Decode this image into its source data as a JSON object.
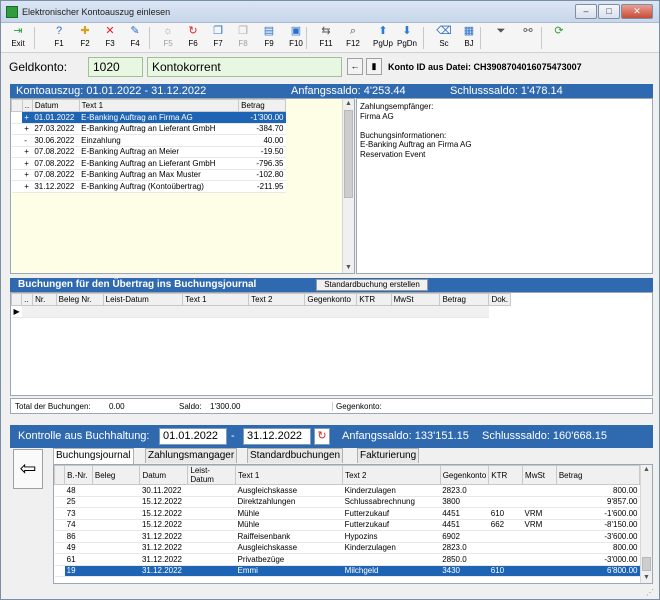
{
  "window": {
    "title": "Elektronischer Kontoauszug einlesen"
  },
  "toolbar": [
    {
      "name": "exit-button",
      "icon": "⇥",
      "label": "Exit",
      "color": "#2d9d3d",
      "disabled": false
    },
    {
      "name": "f1-button",
      "icon": "?",
      "label": "F1",
      "color": "#2a6fc9",
      "disabled": false
    },
    {
      "name": "f2-button",
      "icon": "✚",
      "label": "F2",
      "color": "#d8a21c",
      "disabled": false
    },
    {
      "name": "f3-button",
      "icon": "✕",
      "label": "F3",
      "color": "#d22",
      "disabled": false
    },
    {
      "name": "f4-button",
      "icon": "✎",
      "label": "F4",
      "color": "#2a6fc9",
      "disabled": false
    },
    {
      "name": "f5-button",
      "icon": "☼",
      "label": "F5",
      "color": "#aaa",
      "disabled": true
    },
    {
      "name": "f6-button",
      "icon": "↻",
      "label": "F6",
      "color": "#d22",
      "disabled": false
    },
    {
      "name": "f7-button",
      "icon": "❐",
      "label": "F7",
      "color": "#2a6fc9",
      "disabled": false
    },
    {
      "name": "f8-button",
      "icon": "❐",
      "label": "F8",
      "color": "#aaa",
      "disabled": true
    },
    {
      "name": "f9-button",
      "icon": "▤",
      "label": "F9",
      "color": "#2a6fc9",
      "disabled": false
    },
    {
      "name": "f10-button",
      "icon": "▣",
      "label": "F10",
      "color": "#2a6fc9",
      "disabled": false
    },
    {
      "name": "f11-button",
      "icon": "⇆",
      "label": "F11",
      "color": "#555",
      "disabled": false
    },
    {
      "name": "f12-button",
      "icon": "⌕",
      "label": "F12",
      "color": "#555",
      "disabled": false
    },
    {
      "name": "pgup-button",
      "icon": "⬆",
      "label": "PgUp",
      "color": "#2a7ad6",
      "disabled": false
    },
    {
      "name": "pgdn-button",
      "icon": "⬇",
      "label": "PgDn",
      "color": "#2a7ad6",
      "disabled": false
    },
    {
      "name": "sc-button",
      "icon": "⌫",
      "label": "Sc",
      "color": "#2a6fc9",
      "disabled": false
    },
    {
      "name": "bj-button",
      "icon": "▦",
      "label": "BJ",
      "color": "#2a6fc9",
      "disabled": false
    },
    {
      "name": "filter-button",
      "icon": "⏷",
      "label": "",
      "color": "#555",
      "disabled": false
    },
    {
      "name": "connect-button",
      "icon": "⚯",
      "label": "",
      "color": "#555",
      "disabled": false
    },
    {
      "name": "refresh-button",
      "icon": "⟳",
      "label": "",
      "color": "#2d9d3d",
      "disabled": false
    }
  ],
  "geldkonto": {
    "label": "Geldkonto:",
    "number": "1020",
    "name": "Kontokorrent",
    "konto_id": "Konto ID aus Datei: CH3908704016075473007"
  },
  "kontoauszug": {
    "title": "Kontoauszug:  01.01.2022 - 31.12.2022",
    "anfangssaldo": "Anfangssaldo:  4'253.44",
    "schlusssaldo": "Schlusssaldo:  1'478.14",
    "columns": [
      "..",
      "Datum",
      "Text 1",
      "Betrag"
    ],
    "rows": [
      {
        "mark": "+",
        "datum": "01.01.2022",
        "text": "E-Banking Auftrag an Firma AG",
        "betrag": "-1'300.00",
        "selected": true
      },
      {
        "mark": "+",
        "datum": "27.03.2022",
        "text": "E-Banking Auftrag an Lieferant GmbH",
        "betrag": "-384.70",
        "selected": false
      },
      {
        "mark": "-",
        "datum": "30.06.2022",
        "text": "Einzahlung",
        "betrag": "40.00",
        "selected": false
      },
      {
        "mark": "+",
        "datum": "07.08.2022",
        "text": "E-Banking Auftrag an Meier",
        "betrag": "-19.50",
        "selected": false
      },
      {
        "mark": "+",
        "datum": "07.08.2022",
        "text": "E-Banking Auftrag an Lieferant GmbH",
        "betrag": "-796.35",
        "selected": false
      },
      {
        "mark": "+",
        "datum": "07.08.2022",
        "text": "E-Banking Auftrag an Max Muster",
        "betrag": "-102.80",
        "selected": false
      },
      {
        "mark": "+",
        "datum": "31.12.2022",
        "text": "E-Banking Auftrag (Kontoübertrag)",
        "betrag": "-211.95",
        "selected": false
      }
    ],
    "details": [
      "Zahlungsempfänger:",
      "Firma AG",
      "",
      "Buchungsinformationen:",
      "E-Banking Auftrag an Firma AG",
      "Reservation Event"
    ]
  },
  "buchungen": {
    "title": "Buchungen für den Übertrag ins Buchungsjournal",
    "button": "Standardbuchung erstellen",
    "columns": [
      "..",
      "Nr.",
      "Beleg Nr.",
      "Leist-Datum",
      "Text 1",
      "Text 2",
      "Gegenkonto",
      "KTR",
      "MwSt",
      "Betrag",
      "Dok."
    ],
    "total_label": "Total der Buchungen:",
    "total_value": "0.00",
    "saldo_label": "Saldo:",
    "saldo_value": "1'300.00",
    "gegenkonto_label": "Gegenkonto:"
  },
  "kontrolle": {
    "title": "Kontrolle aus Buchhaltung:",
    "from": "01.01.2022",
    "dash": "-",
    "to": "31.12.2022",
    "anfangssaldo": "Anfangssaldo:  133'151.15",
    "schlusssaldo": "Schlusssaldo:  160'668.15",
    "tabs": [
      "Buchungsjournal",
      "Zahlungsmangager",
      "Standardbuchungen",
      "Fakturierung"
    ],
    "columns": [
      "B.-Nr.",
      "Beleg",
      "Datum",
      "Leist-Datum",
      "Text 1",
      "Text 2",
      "Gegenkonto",
      "KTR",
      "MwSt",
      "Betrag"
    ],
    "rows": [
      {
        "nr": "48",
        "beleg": "",
        "datum": "30.11.2022",
        "leist": "",
        "text1": "Ausgleichskasse",
        "text2": "Kinderzulagen",
        "gk": "2823.0",
        "ktr": "",
        "mwst": "",
        "betrag": "800.00",
        "selected": false
      },
      {
        "nr": "25",
        "beleg": "",
        "datum": "15.12.2022",
        "leist": "",
        "text1": "Direktzahlungen",
        "text2": "Schlussabrechnung",
        "gk": "3800",
        "ktr": "",
        "mwst": "",
        "betrag": "9'857.00",
        "selected": false
      },
      {
        "nr": "73",
        "beleg": "",
        "datum": "15.12.2022",
        "leist": "",
        "text1": "Mühle",
        "text2": "Futterzukauf",
        "gk": "4451",
        "ktr": "610",
        "mwst": "VRM",
        "betrag": "-1'600.00",
        "selected": false
      },
      {
        "nr": "74",
        "beleg": "",
        "datum": "15.12.2022",
        "leist": "",
        "text1": "Mühle",
        "text2": "Futterzukauf",
        "gk": "4451",
        "ktr": "662",
        "mwst": "VRM",
        "betrag": "-8'150.00",
        "selected": false
      },
      {
        "nr": "86",
        "beleg": "",
        "datum": "31.12.2022",
        "leist": "",
        "text1": "Raiffeisenbank",
        "text2": "Hypozins",
        "gk": "6902",
        "ktr": "",
        "mwst": "",
        "betrag": "-3'600.00",
        "selected": false
      },
      {
        "nr": "49",
        "beleg": "",
        "datum": "31.12.2022",
        "leist": "",
        "text1": "Ausgleichskasse",
        "text2": "Kinderzulagen",
        "gk": "2823.0",
        "ktr": "",
        "mwst": "",
        "betrag": "800.00",
        "selected": false
      },
      {
        "nr": "61",
        "beleg": "",
        "datum": "31.12.2022",
        "leist": "",
        "text1": "Privatbezüge",
        "text2": "",
        "gk": "2850.0",
        "ktr": "",
        "mwst": "",
        "betrag": "-3'000.00",
        "selected": false
      },
      {
        "nr": "19",
        "beleg": "",
        "datum": "31.12.2022",
        "leist": "",
        "text1": "Emmi",
        "text2": "Milchgeld",
        "gk": "3430",
        "ktr": "610",
        "mwst": "",
        "betrag": "6'800.00",
        "selected": true
      }
    ]
  },
  "colors": {
    "accent": "#2f6ab0",
    "selection": "#1e64b4",
    "field_green": "#e8f7e2",
    "panel_yellow": "#fefee6"
  }
}
